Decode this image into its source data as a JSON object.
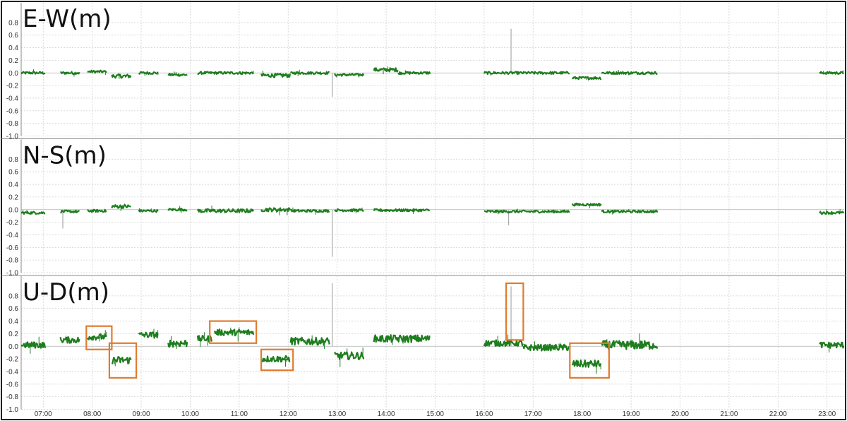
{
  "chart_data": {
    "type": "line",
    "x_ticks": [
      "07:00",
      "08:00",
      "09:00",
      "10:00",
      "11:00",
      "12:00",
      "13:00",
      "14:00",
      "15:00",
      "16:00",
      "17:00",
      "18:00",
      "19:00",
      "20:00",
      "21:00",
      "22:00",
      "23:00"
    ],
    "xlim_hours": [
      6.55,
      23.35
    ],
    "y_ticks": [
      "0.8",
      "0.6",
      "0.4",
      "0.2",
      "0.0",
      "-0.2",
      "-0.4",
      "-0.6",
      "-0.8",
      "-1.0"
    ],
    "ylim": [
      -1.0,
      1.0
    ],
    "grid": true,
    "series_color": "#1e7d1e",
    "spike_color": "#aaaaaa",
    "highlight_color": "#e07b2e",
    "panels": [
      {
        "title": "E-W(m)",
        "segments": [
          {
            "start": 6.55,
            "end": 7.05,
            "level": 0.0,
            "noise": 0.02
          },
          {
            "start": 7.35,
            "end": 7.75,
            "level": 0.0,
            "noise": 0.02
          },
          {
            "start": 7.9,
            "end": 8.3,
            "level": 0.02,
            "noise": 0.02
          },
          {
            "start": 8.4,
            "end": 8.8,
            "level": -0.05,
            "noise": 0.03
          },
          {
            "start": 8.95,
            "end": 9.35,
            "level": 0.0,
            "noise": 0.02
          },
          {
            "start": 9.55,
            "end": 9.95,
            "level": -0.03,
            "noise": 0.02
          },
          {
            "start": 10.15,
            "end": 11.3,
            "level": 0.0,
            "noise": 0.02
          },
          {
            "start": 11.45,
            "end": 12.05,
            "level": -0.04,
            "noise": 0.03
          },
          {
            "start": 12.05,
            "end": 12.85,
            "level": 0.0,
            "noise": 0.02
          },
          {
            "start": 12.95,
            "end": 13.55,
            "level": -0.03,
            "noise": 0.02
          },
          {
            "start": 13.75,
            "end": 14.25,
            "level": 0.05,
            "noise": 0.03
          },
          {
            "start": 14.25,
            "end": 14.9,
            "level": 0.0,
            "noise": 0.02
          },
          {
            "start": 16.0,
            "end": 17.75,
            "level": 0.0,
            "noise": 0.02
          },
          {
            "start": 17.8,
            "end": 18.4,
            "level": -0.08,
            "noise": 0.02
          },
          {
            "start": 18.4,
            "end": 19.55,
            "level": 0.0,
            "noise": 0.02
          },
          {
            "start": 22.85,
            "end": 23.35,
            "level": 0.0,
            "noise": 0.02
          }
        ],
        "spikes": [
          {
            "x": 16.55,
            "y": 0.7
          },
          {
            "x": 12.9,
            "y": -0.38
          }
        ],
        "highlights": []
      },
      {
        "title": "N-S(m)",
        "segments": [
          {
            "start": 6.55,
            "end": 7.05,
            "level": -0.05,
            "noise": 0.02
          },
          {
            "start": 7.35,
            "end": 7.75,
            "level": -0.03,
            "noise": 0.02
          },
          {
            "start": 7.9,
            "end": 8.3,
            "level": -0.02,
            "noise": 0.02
          },
          {
            "start": 8.4,
            "end": 8.8,
            "level": 0.05,
            "noise": 0.03
          },
          {
            "start": 8.95,
            "end": 9.35,
            "level": -0.02,
            "noise": 0.02
          },
          {
            "start": 9.55,
            "end": 9.95,
            "level": 0.0,
            "noise": 0.02
          },
          {
            "start": 10.15,
            "end": 11.3,
            "level": -0.02,
            "noise": 0.03
          },
          {
            "start": 11.45,
            "end": 12.05,
            "level": 0.0,
            "noise": 0.03
          },
          {
            "start": 12.05,
            "end": 12.85,
            "level": -0.02,
            "noise": 0.02
          },
          {
            "start": 12.95,
            "end": 13.55,
            "level": -0.01,
            "noise": 0.02
          },
          {
            "start": 13.75,
            "end": 14.9,
            "level": -0.01,
            "noise": 0.02
          },
          {
            "start": 16.0,
            "end": 17.75,
            "level": -0.03,
            "noise": 0.02
          },
          {
            "start": 17.8,
            "end": 18.4,
            "level": 0.08,
            "noise": 0.02
          },
          {
            "start": 18.4,
            "end": 19.55,
            "level": -0.03,
            "noise": 0.02
          },
          {
            "start": 22.85,
            "end": 23.35,
            "level": -0.05,
            "noise": 0.02
          }
        ],
        "spikes": [
          {
            "x": 12.9,
            "y": -0.75
          },
          {
            "x": 7.4,
            "y": -0.3
          },
          {
            "x": 16.5,
            "y": -0.25
          }
        ],
        "highlights": []
      },
      {
        "title": "U-D(m)",
        "segments": [
          {
            "start": 6.55,
            "end": 7.05,
            "level": 0.02,
            "noise": 0.05
          },
          {
            "start": 7.35,
            "end": 7.75,
            "level": 0.1,
            "noise": 0.05
          },
          {
            "start": 7.9,
            "end": 8.3,
            "level": 0.15,
            "noise": 0.05
          },
          {
            "start": 8.4,
            "end": 8.8,
            "level": -0.22,
            "noise": 0.06
          },
          {
            "start": 8.95,
            "end": 9.35,
            "level": 0.18,
            "noise": 0.05
          },
          {
            "start": 9.55,
            "end": 9.95,
            "level": 0.05,
            "noise": 0.06
          },
          {
            "start": 10.15,
            "end": 10.45,
            "level": 0.12,
            "noise": 0.05
          },
          {
            "start": 10.5,
            "end": 11.3,
            "level": 0.22,
            "noise": 0.05
          },
          {
            "start": 11.45,
            "end": 12.05,
            "level": -0.2,
            "noise": 0.05
          },
          {
            "start": 12.05,
            "end": 12.85,
            "level": 0.08,
            "noise": 0.06
          },
          {
            "start": 12.95,
            "end": 13.55,
            "level": -0.15,
            "noise": 0.06
          },
          {
            "start": 13.75,
            "end": 14.9,
            "level": 0.12,
            "noise": 0.06
          },
          {
            "start": 16.0,
            "end": 16.8,
            "level": 0.05,
            "noise": 0.05
          },
          {
            "start": 16.8,
            "end": 17.75,
            "level": -0.02,
            "noise": 0.05
          },
          {
            "start": 17.8,
            "end": 18.4,
            "level": -0.28,
            "noise": 0.06
          },
          {
            "start": 18.4,
            "end": 19.55,
            "level": 0.02,
            "noise": 0.07
          },
          {
            "start": 22.85,
            "end": 23.35,
            "level": 0.02,
            "noise": 0.05
          }
        ],
        "spikes": [
          {
            "x": 12.9,
            "y": 1.0
          },
          {
            "x": 16.55,
            "y": 0.95
          }
        ],
        "highlights": [
          {
            "x0": 7.88,
            "x1": 8.4,
            "y0": -0.05,
            "y1": 0.32
          },
          {
            "x0": 8.35,
            "x1": 8.9,
            "y0": -0.5,
            "y1": 0.05
          },
          {
            "x0": 10.4,
            "x1": 11.35,
            "y0": 0.05,
            "y1": 0.4
          },
          {
            "x0": 11.45,
            "x1": 12.1,
            "y0": -0.38,
            "y1": -0.05
          },
          {
            "x0": 16.45,
            "x1": 16.8,
            "y0": 0.1,
            "y1": 1.0
          },
          {
            "x0": 17.75,
            "x1": 18.55,
            "y0": -0.5,
            "y1": 0.05
          }
        ]
      }
    ]
  }
}
